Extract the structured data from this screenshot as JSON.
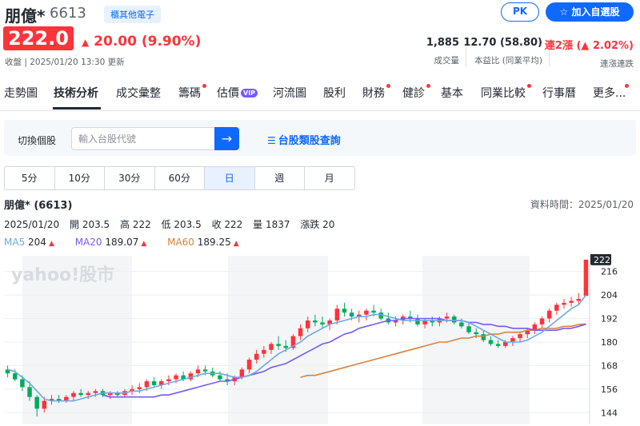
{
  "stock": {
    "name": "朋億*",
    "code": "6613",
    "category": "櫃其他電子",
    "price": "222.0",
    "change": "20.00 (9.90%)",
    "updated": "收盤 | 2025/01/20 13:30 更新"
  },
  "actions": {
    "pk": "PK",
    "add_watchlist": "加入自選股"
  },
  "stats": [
    {
      "value": "1,885",
      "label": "成交量"
    },
    {
      "value": "12.70 (58.80)",
      "label": "本益比 (同業平均)"
    },
    {
      "value": "連2漲 (▲ 2.02%)",
      "label": "連漲連跌"
    }
  ],
  "nav": [
    "走勢圖",
    "技術分析",
    "成交彙整",
    "籌碼",
    "估價",
    "河流圖",
    "股利",
    "財務",
    "健診",
    "基本",
    "同業比較",
    "行事曆",
    "更多..."
  ],
  "nav_vip": "VIP",
  "search": {
    "label": "切換個股",
    "placeholder": "輸入台股代號",
    "category_link": "台股類股查詢"
  },
  "periods": [
    "5分",
    "10分",
    "30分",
    "60分",
    "日",
    "週",
    "月"
  ],
  "chart_info": {
    "name": "朋億* (6613)",
    "data_time": "資料時間：2025/01/20",
    "date": "2025/01/20",
    "open": "開 203.5",
    "high": "高 222",
    "low": "低 203.5",
    "close": "收 222",
    "volume": "量 1837",
    "change": "漲跌 20"
  },
  "ma": [
    {
      "label": "MA5",
      "value": "204",
      "color": "#6ea9e0"
    },
    {
      "label": "MA20",
      "value": "189.07",
      "color": "#7759ff"
    },
    {
      "label": "MA60",
      "value": "189.25",
      "color": "#d9823b"
    }
  ],
  "colors": {
    "up": "#ff333a",
    "down": "#00ab5e",
    "accent": "#0f69ff"
  },
  "watermark": "yahoo!股市",
  "chart_data": {
    "type": "candlestick",
    "y_ticks": [
      144,
      156,
      168,
      180,
      192,
      204,
      216
    ],
    "last_price_label": "222",
    "ylim": [
      138,
      224
    ],
    "ohlc": [
      [
        166,
        168,
        162,
        164
      ],
      [
        164,
        166,
        160,
        161
      ],
      [
        161,
        163,
        155,
        157
      ],
      [
        157,
        160,
        150,
        152
      ],
      [
        152,
        153,
        142,
        146
      ],
      [
        146,
        152,
        144,
        150
      ],
      [
        150,
        153,
        148,
        151
      ],
      [
        151,
        153,
        149,
        150
      ],
      [
        150,
        153,
        149,
        152
      ],
      [
        152,
        155,
        150,
        154
      ],
      [
        154,
        156,
        152,
        153
      ],
      [
        153,
        155,
        151,
        154
      ],
      [
        154,
        156,
        152,
        155
      ],
      [
        155,
        156,
        152,
        153
      ],
      [
        153,
        155,
        151,
        154
      ],
      [
        154,
        155,
        152,
        153
      ],
      [
        153,
        156,
        152,
        155
      ],
      [
        155,
        158,
        153,
        156
      ],
      [
        156,
        159,
        154,
        157
      ],
      [
        157,
        161,
        155,
        160
      ],
      [
        160,
        162,
        157,
        158
      ],
      [
        158,
        161,
        156,
        160
      ],
      [
        160,
        163,
        158,
        161
      ],
      [
        161,
        164,
        159,
        163
      ],
      [
        163,
        165,
        160,
        161
      ],
      [
        161,
        165,
        160,
        164
      ],
      [
        164,
        168,
        162,
        166
      ],
      [
        166,
        168,
        163,
        165
      ],
      [
        165,
        167,
        162,
        163
      ],
      [
        163,
        165,
        160,
        161
      ],
      [
        161,
        164,
        158,
        160
      ],
      [
        160,
        163,
        158,
        162
      ],
      [
        162,
        167,
        161,
        166
      ],
      [
        166,
        172,
        164,
        171
      ],
      [
        171,
        176,
        169,
        174
      ],
      [
        174,
        178,
        172,
        176
      ],
      [
        176,
        180,
        174,
        179
      ],
      [
        179,
        183,
        176,
        178
      ],
      [
        178,
        181,
        175,
        177
      ],
      [
        177,
        184,
        176,
        183
      ],
      [
        183,
        189,
        181,
        187
      ],
      [
        187,
        193,
        185,
        191
      ],
      [
        191,
        194,
        188,
        190
      ],
      [
        190,
        193,
        187,
        189
      ],
      [
        189,
        192,
        186,
        191
      ],
      [
        191,
        199,
        189,
        197
      ],
      [
        197,
        200,
        193,
        195
      ],
      [
        195,
        197,
        191,
        193
      ],
      [
        193,
        196,
        190,
        194
      ],
      [
        194,
        197,
        191,
        196
      ],
      [
        196,
        199,
        193,
        195
      ],
      [
        195,
        197,
        191,
        192
      ],
      [
        192,
        195,
        189,
        190
      ],
      [
        190,
        193,
        188,
        191
      ],
      [
        191,
        194,
        189,
        193
      ],
      [
        193,
        196,
        190,
        192
      ],
      [
        192,
        194,
        188,
        189
      ],
      [
        189,
        192,
        187,
        191
      ],
      [
        191,
        193,
        188,
        190
      ],
      [
        190,
        193,
        188,
        192
      ],
      [
        192,
        195,
        190,
        193
      ],
      [
        193,
        194,
        189,
        190
      ],
      [
        190,
        192,
        187,
        188
      ],
      [
        188,
        190,
        184,
        185
      ],
      [
        185,
        187,
        182,
        184
      ],
      [
        184,
        186,
        180,
        181
      ],
      [
        181,
        183,
        178,
        179
      ],
      [
        179,
        181,
        177,
        178
      ],
      [
        178,
        181,
        177,
        180
      ],
      [
        180,
        183,
        178,
        182
      ],
      [
        182,
        185,
        180,
        184
      ],
      [
        184,
        187,
        182,
        186
      ],
      [
        186,
        190,
        184,
        189
      ],
      [
        189,
        193,
        187,
        192
      ],
      [
        192,
        197,
        190,
        196
      ],
      [
        196,
        200,
        194,
        199
      ],
      [
        199,
        202,
        197,
        200
      ],
      [
        200,
        203,
        198,
        201
      ],
      [
        201,
        205,
        199,
        202
      ],
      [
        203.5,
        222,
        203.5,
        222
      ]
    ],
    "ma5": [
      166,
      165,
      162,
      159,
      155,
      151,
      150,
      150,
      150,
      150,
      151,
      152,
      153,
      154,
      154,
      154,
      154,
      155,
      155,
      156,
      157,
      158,
      159,
      160,
      161,
      162,
      163,
      164,
      164,
      164,
      163,
      162,
      162,
      163,
      165,
      168,
      171,
      174,
      176,
      178,
      180,
      183,
      185,
      187,
      189,
      190,
      191,
      192,
      193,
      193,
      194,
      194,
      193,
      192,
      191,
      191,
      191,
      191,
      191,
      191,
      191,
      191,
      191,
      190,
      188,
      186,
      184,
      182,
      180,
      180,
      180,
      181,
      183,
      185,
      188,
      191,
      194,
      197,
      199,
      204
    ],
    "ma20": [
      null,
      null,
      null,
      null,
      null,
      null,
      null,
      null,
      null,
      null,
      null,
      null,
      null,
      153,
      152,
      152,
      152,
      152,
      152,
      152,
      152,
      153,
      153,
      154,
      155,
      156,
      157,
      158,
      159,
      160,
      160,
      161,
      162,
      163,
      164,
      165,
      167,
      168,
      169,
      171,
      173,
      175,
      177,
      179,
      180,
      182,
      184,
      185,
      187,
      188,
      189,
      190,
      191,
      191,
      192,
      192,
      192,
      192,
      192,
      192,
      191,
      191,
      191,
      190,
      190,
      189,
      189,
      188,
      188,
      187,
      187,
      187,
      186,
      186,
      186,
      186,
      187,
      187,
      188,
      189.07
    ],
    "ma60": [
      null,
      null,
      null,
      null,
      null,
      null,
      null,
      null,
      null,
      null,
      null,
      null,
      null,
      null,
      null,
      null,
      null,
      null,
      null,
      null,
      null,
      null,
      null,
      null,
      null,
      null,
      null,
      null,
      null,
      null,
      null,
      null,
      null,
      null,
      null,
      null,
      null,
      null,
      null,
      null,
      162,
      163,
      163,
      164,
      165,
      166,
      167,
      168,
      169,
      170,
      171,
      172,
      173,
      174,
      175,
      176,
      177,
      178,
      179,
      180,
      180,
      181,
      182,
      182,
      183,
      183,
      184,
      184,
      185,
      185,
      185,
      186,
      186,
      187,
      187,
      187,
      188,
      188,
      189,
      189.25
    ]
  }
}
